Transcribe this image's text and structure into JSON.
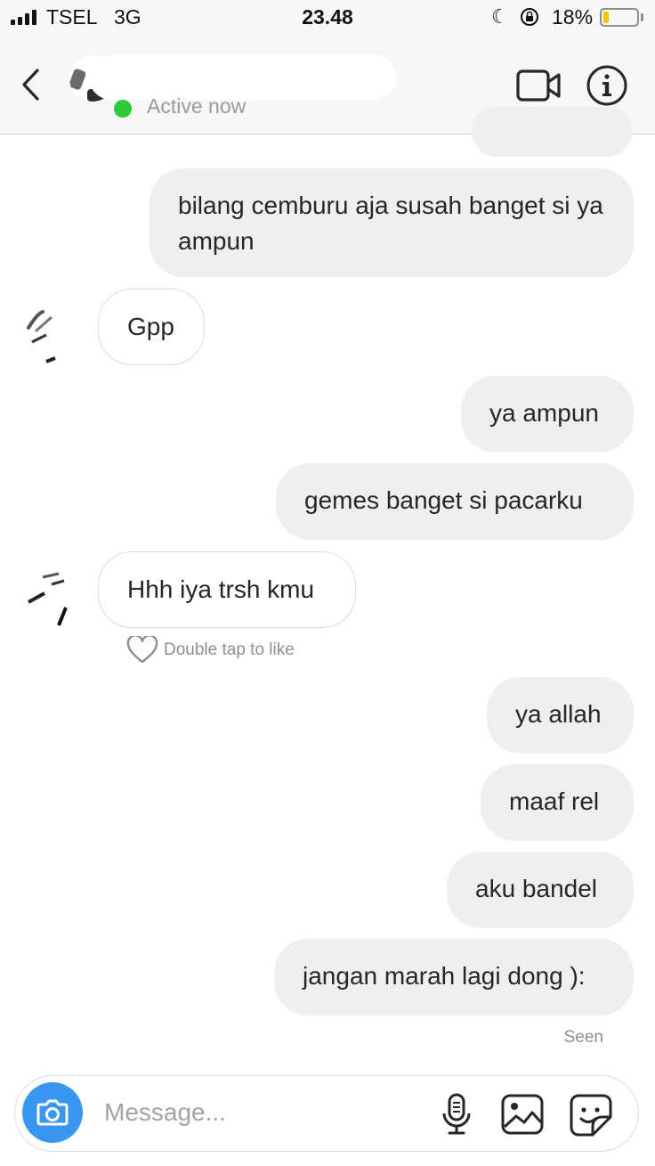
{
  "status_bar": {
    "carrier": "TSEL",
    "network": "3G",
    "time": "23.48",
    "battery_percent": "18%",
    "battery_level": 0.18,
    "icons": [
      "signal-icon",
      "moon-icon",
      "rotation-lock-icon",
      "battery-icon"
    ]
  },
  "header": {
    "active_status": "Active now",
    "online_color": "#2ec93b",
    "icons": [
      "back-chevron-icon",
      "video-call-icon",
      "info-icon"
    ]
  },
  "messages": [
    {
      "side": "out",
      "text": "bilang cemburu aja susah banget si ya ampun"
    },
    {
      "side": "in",
      "text": "Gpp"
    },
    {
      "side": "out",
      "text": "ya ampun"
    },
    {
      "side": "out",
      "text": "gemes banget si pacarku"
    },
    {
      "side": "in",
      "text": "Hhh iya trsh kmu"
    },
    {
      "side": "out",
      "text": "ya allah"
    },
    {
      "side": "out",
      "text": "maaf rel"
    },
    {
      "side": "out",
      "text": "aku bandel"
    },
    {
      "side": "out",
      "text": "jangan marah lagi dong ):"
    }
  ],
  "like_hint": "Double tap to like",
  "seen_label": "Seen",
  "composer": {
    "placeholder": "Message...",
    "camera_color": "#3897f0",
    "icons": [
      "camera-icon",
      "microphone-icon",
      "gallery-icon",
      "sticker-icon"
    ]
  }
}
